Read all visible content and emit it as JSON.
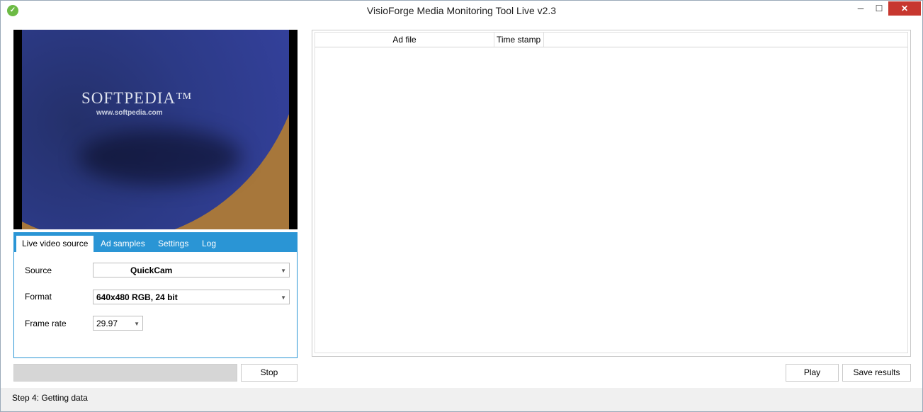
{
  "window": {
    "title": "VisioForge Media Monitoring Tool Live v2.3"
  },
  "video_preview": {
    "logo_text": "SOFTPEDIA™",
    "url_text": "www.softpedia.com"
  },
  "tabs": [
    {
      "label": "Live video source",
      "active": true
    },
    {
      "label": "Ad samples",
      "active": false
    },
    {
      "label": "Settings",
      "active": false
    },
    {
      "label": "Log",
      "active": false
    }
  ],
  "form": {
    "source_label": "Source",
    "source_value": "QuickCam",
    "format_label": "Format",
    "format_value": "640x480 RGB, 24 bit",
    "framerate_label": "Frame rate",
    "framerate_value": "29.97"
  },
  "buttons": {
    "stop": "Stop",
    "play": "Play",
    "save_results": "Save results"
  },
  "results_table": {
    "columns": [
      "Ad file",
      "Time stamp"
    ],
    "rows": []
  },
  "status": {
    "text": "Step 4: Getting data"
  },
  "colors": {
    "accent": "#2a95d5",
    "close": "#c7372f"
  }
}
